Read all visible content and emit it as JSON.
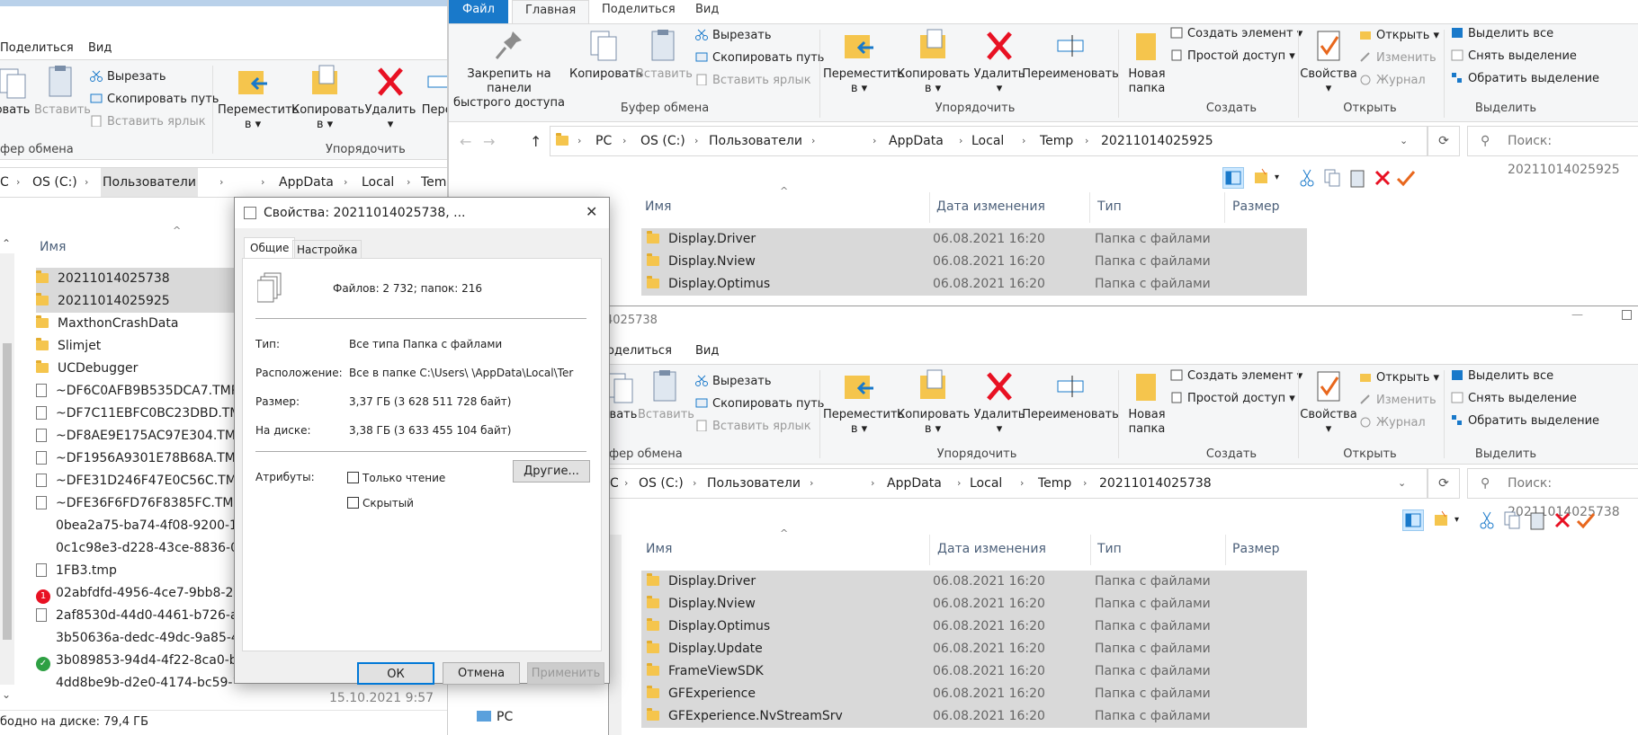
{
  "left_window": {
    "tabs": [
      "Поделиться",
      "Вид"
    ],
    "ribbon": {
      "copy_partial": "овать",
      "paste": "Вставить",
      "cut": "Вырезать",
      "copy_path": "Скопировать путь",
      "paste_shortcut": "Вставить ярлык",
      "clipboard_partial": "фер обмена",
      "move_to": "Переместить",
      "copy_to": "Копировать",
      "in": "в",
      "delete": "Удалить",
      "rename_partial": "Переи",
      "organize": "Упорядочить"
    },
    "address": [
      "C",
      "OS (C:)",
      "Пользователи",
      "AppData",
      "Local",
      "Tem"
    ],
    "col_name": "Имя",
    "files": [
      {
        "name": "20211014025738",
        "type": "folder"
      },
      {
        "name": "20211014025925",
        "type": "folder"
      },
      {
        "name": "MaxthonCrashData",
        "type": "folder"
      },
      {
        "name": "Slimjet",
        "type": "folder"
      },
      {
        "name": "UCDebugger",
        "type": "folder"
      },
      {
        "name": "~DF6C0AFB9B535DCA7.TMP",
        "type": "file"
      },
      {
        "name": "~DF7C11EBFC0BC23DBD.TMP",
        "type": "file"
      },
      {
        "name": "~DF8AE9E175AC97E304.TMP",
        "type": "file"
      },
      {
        "name": "~DF1956A9301E78B68A.TMP",
        "type": "file"
      },
      {
        "name": "~DFE31D246F47E0C56C.TMP",
        "type": "file"
      },
      {
        "name": "~DFE36F6FD76F8385FC.TMP",
        "type": "file"
      },
      {
        "name": "0bea2a75-ba74-4f08-9200-1",
        "type": "blank"
      },
      {
        "name": "0c1c98e3-d228-43ce-8836-0",
        "type": "blank"
      },
      {
        "name": "1FB3.tmp",
        "type": "file"
      },
      {
        "name": "02abfdfd-4956-4ce7-9bb8-2",
        "type": "red"
      },
      {
        "name": "2af8530d-44d0-4461-b726-a",
        "type": "file"
      },
      {
        "name": "3b50636a-dedc-49dc-9a85-4",
        "type": "blank"
      },
      {
        "name": "3b089853-94d4-4f22-8ca0-b",
        "type": "green"
      },
      {
        "name": "4dd8be9b-d2e0-4174-bc59-17325834c5...",
        "type": "blank"
      }
    ],
    "last_date": "15.10.2021 9:57",
    "status": "бодно на диске: 79,4 ГБ",
    "badge_number": "1"
  },
  "top_window": {
    "tabs": {
      "file": "Файл",
      "home": "Главная",
      "share": "Поделиться",
      "view": "Вид"
    },
    "ribbon": {
      "pin": "Закрепить на панели",
      "pin2": "быстрого доступа",
      "copy": "Копировать",
      "paste": "Вставить",
      "cut": "Вырезать",
      "copy_path": "Скопировать путь",
      "paste_shortcut": "Вставить ярлык",
      "clipboard": "Буфер обмена",
      "move_to": "Переместить",
      "copy_to": "Копировать",
      "in": "в",
      "delete": "Удалить",
      "rename": "Переименовать",
      "organize": "Упорядочить",
      "new_folder": "Новая",
      "new_folder2": "папка",
      "new_item": "Создать элемент",
      "easy_access": "Простой доступ",
      "create": "Создать",
      "properties": "Свойства",
      "open": "Открыть",
      "edit": "Изменить",
      "history": "Журнал",
      "open_group": "Открыть",
      "select_all": "Выделить все",
      "select_none": "Снять выделение",
      "invert": "Обратить выделение",
      "select_group": "Выделить"
    },
    "address": [
      "PC",
      "OS (C:)",
      "Пользователи",
      "AppData",
      "Local",
      "Temp",
      "20211014025925"
    ],
    "search": "Поиск: 20211014025925",
    "columns": {
      "name": "Имя",
      "date": "Дата изменения",
      "type": "Тип",
      "size": "Размер"
    },
    "rows": [
      {
        "name": "Display.Driver",
        "date": "06.08.2021 16:20",
        "type": "Папка с файлами"
      },
      {
        "name": "Display.Nview",
        "date": "06.08.2021 16:20",
        "type": "Папка с файлами"
      },
      {
        "name": "Display.Optimus",
        "date": "06.08.2021 16:20",
        "type": "Папка с файлами"
      }
    ]
  },
  "bottom_window": {
    "title": "4025738",
    "tabs": {
      "share": "оделиться",
      "view": "Вид"
    },
    "ribbon": {
      "copy_partial": "овать",
      "paste": "Вставить",
      "clipboard_partial": "фер обмена"
    },
    "address": [
      "C",
      "OS (C:)",
      "Пользователи",
      "AppData",
      "Local",
      "Temp",
      "20211014025738"
    ],
    "search": "Поиск: 20211014025738",
    "rows": [
      {
        "name": "Display.Driver",
        "date": "06.08.2021 16:20",
        "type": "Папка с файлами"
      },
      {
        "name": "Display.Nview",
        "date": "06.08.2021 16:20",
        "type": "Папка с файлами"
      },
      {
        "name": "Display.Optimus",
        "date": "06.08.2021 16:20",
        "type": "Папка с файлами"
      },
      {
        "name": "Display.Update",
        "date": "06.08.2021 16:20",
        "type": "Папка с файлами"
      },
      {
        "name": "FrameViewSDK",
        "date": "06.08.2021 16:20",
        "type": "Папка с файлами"
      },
      {
        "name": "GFExperience",
        "date": "06.08.2021 16:20",
        "type": "Папка с файлами"
      },
      {
        "name": "GFExperience.NvStreamSrv",
        "date": "06.08.2021 16:20",
        "type": "Папка с файлами"
      }
    ],
    "nav_pc": "PC"
  },
  "dialog": {
    "title": "Свойства: 20211014025738, ...",
    "tabs": [
      "Общие",
      "Настройка"
    ],
    "summary": "Файлов: 2 732; папок: 216",
    "type_label": "Тип:",
    "type_value": "Все типа Папка с файлами",
    "location_label": "Расположение:",
    "location_value": "Все в папке C:\\Users\\     \\AppData\\Local\\Ter",
    "size_label": "Размер:",
    "size_value": "3,37 ГБ (3 628 511 728 байт)",
    "disk_label": "На диске:",
    "disk_value": "3,38 ГБ (3 633 455 104 байт)",
    "attributes_label": "Атрибуты:",
    "readonly": "Только чтение",
    "hidden": "Скрытый",
    "other_button": "Другие...",
    "ok": "ОК",
    "cancel": "Отмена",
    "apply": "Применить"
  },
  "colors": {
    "file_tab": "#1979ca",
    "selection": "#d9d9d9",
    "folder": "#f5c54d",
    "delete_red": "#e81123"
  }
}
